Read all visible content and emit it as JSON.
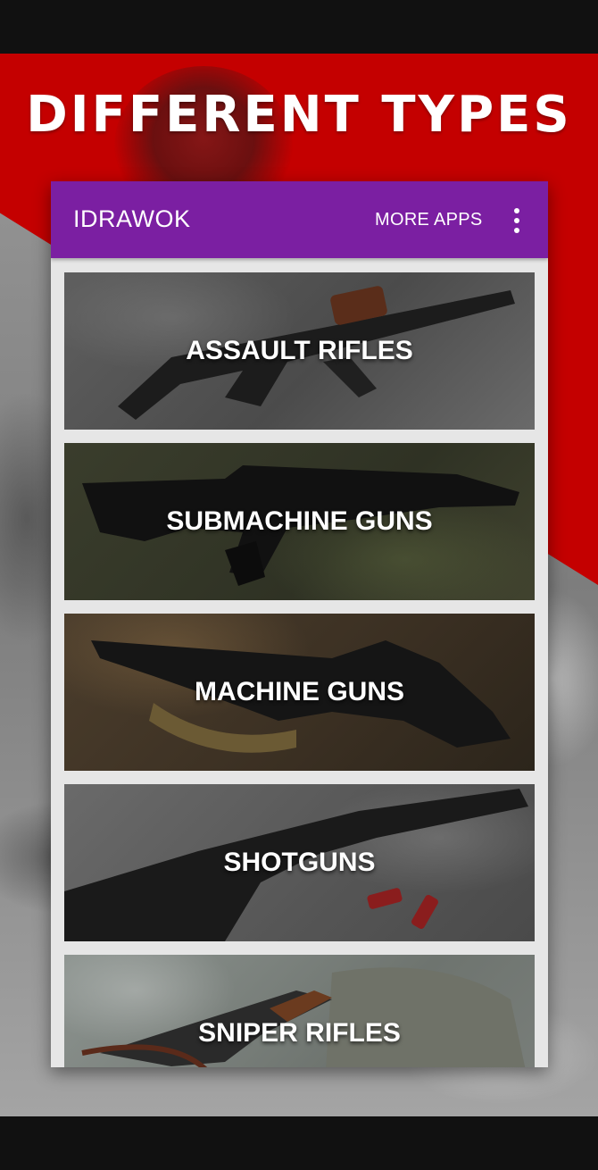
{
  "promo": {
    "title": "DIFFERENT TYPES",
    "accent_red": "#c40000"
  },
  "toolbar": {
    "title": "IDRAWOK",
    "more_apps_label": "MORE APPS",
    "overflow_icon": "more-vert-icon",
    "color": "#7b1fa2"
  },
  "categories": [
    {
      "label": "ASSAULT RIFLES"
    },
    {
      "label": "SUBMACHINE GUNS"
    },
    {
      "label": "MACHINE GUNS"
    },
    {
      "label": "SHOTGUNS"
    },
    {
      "label": "SNIPER RIFLES"
    }
  ]
}
